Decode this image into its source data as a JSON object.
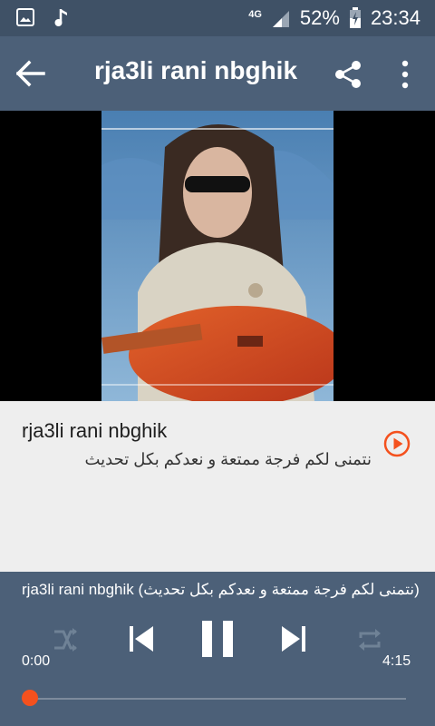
{
  "status_bar": {
    "network": "4G",
    "battery": "52%",
    "time": "23:34",
    "icons": [
      "image-icon",
      "music-note-icon",
      "signal-icon",
      "battery-icon"
    ]
  },
  "app_bar": {
    "title": "rja3li rani nbghik",
    "icons": [
      "back-arrow-icon",
      "share-icon",
      "more-vert-icon"
    ]
  },
  "track": {
    "title": "rja3li rani nbghik",
    "subtitle": "نتمنى لكم فرجة ممتعة و نعدكم بكل تحديث"
  },
  "player": {
    "now_playing": "rja3li rani nbghik (نتمنى لكم فرجة ممتعة و نعدكم بكل تحديث)",
    "elapsed": "0:00",
    "duration": "4:15",
    "progress": 0,
    "controls": [
      "shuffle-icon",
      "previous-icon",
      "pause-icon",
      "next-icon",
      "repeat-icon"
    ]
  },
  "colors": {
    "status_bar": "#3f5166",
    "app_bar": "#4c6078",
    "accent": "#f4511e",
    "background": "#eeeeee"
  }
}
